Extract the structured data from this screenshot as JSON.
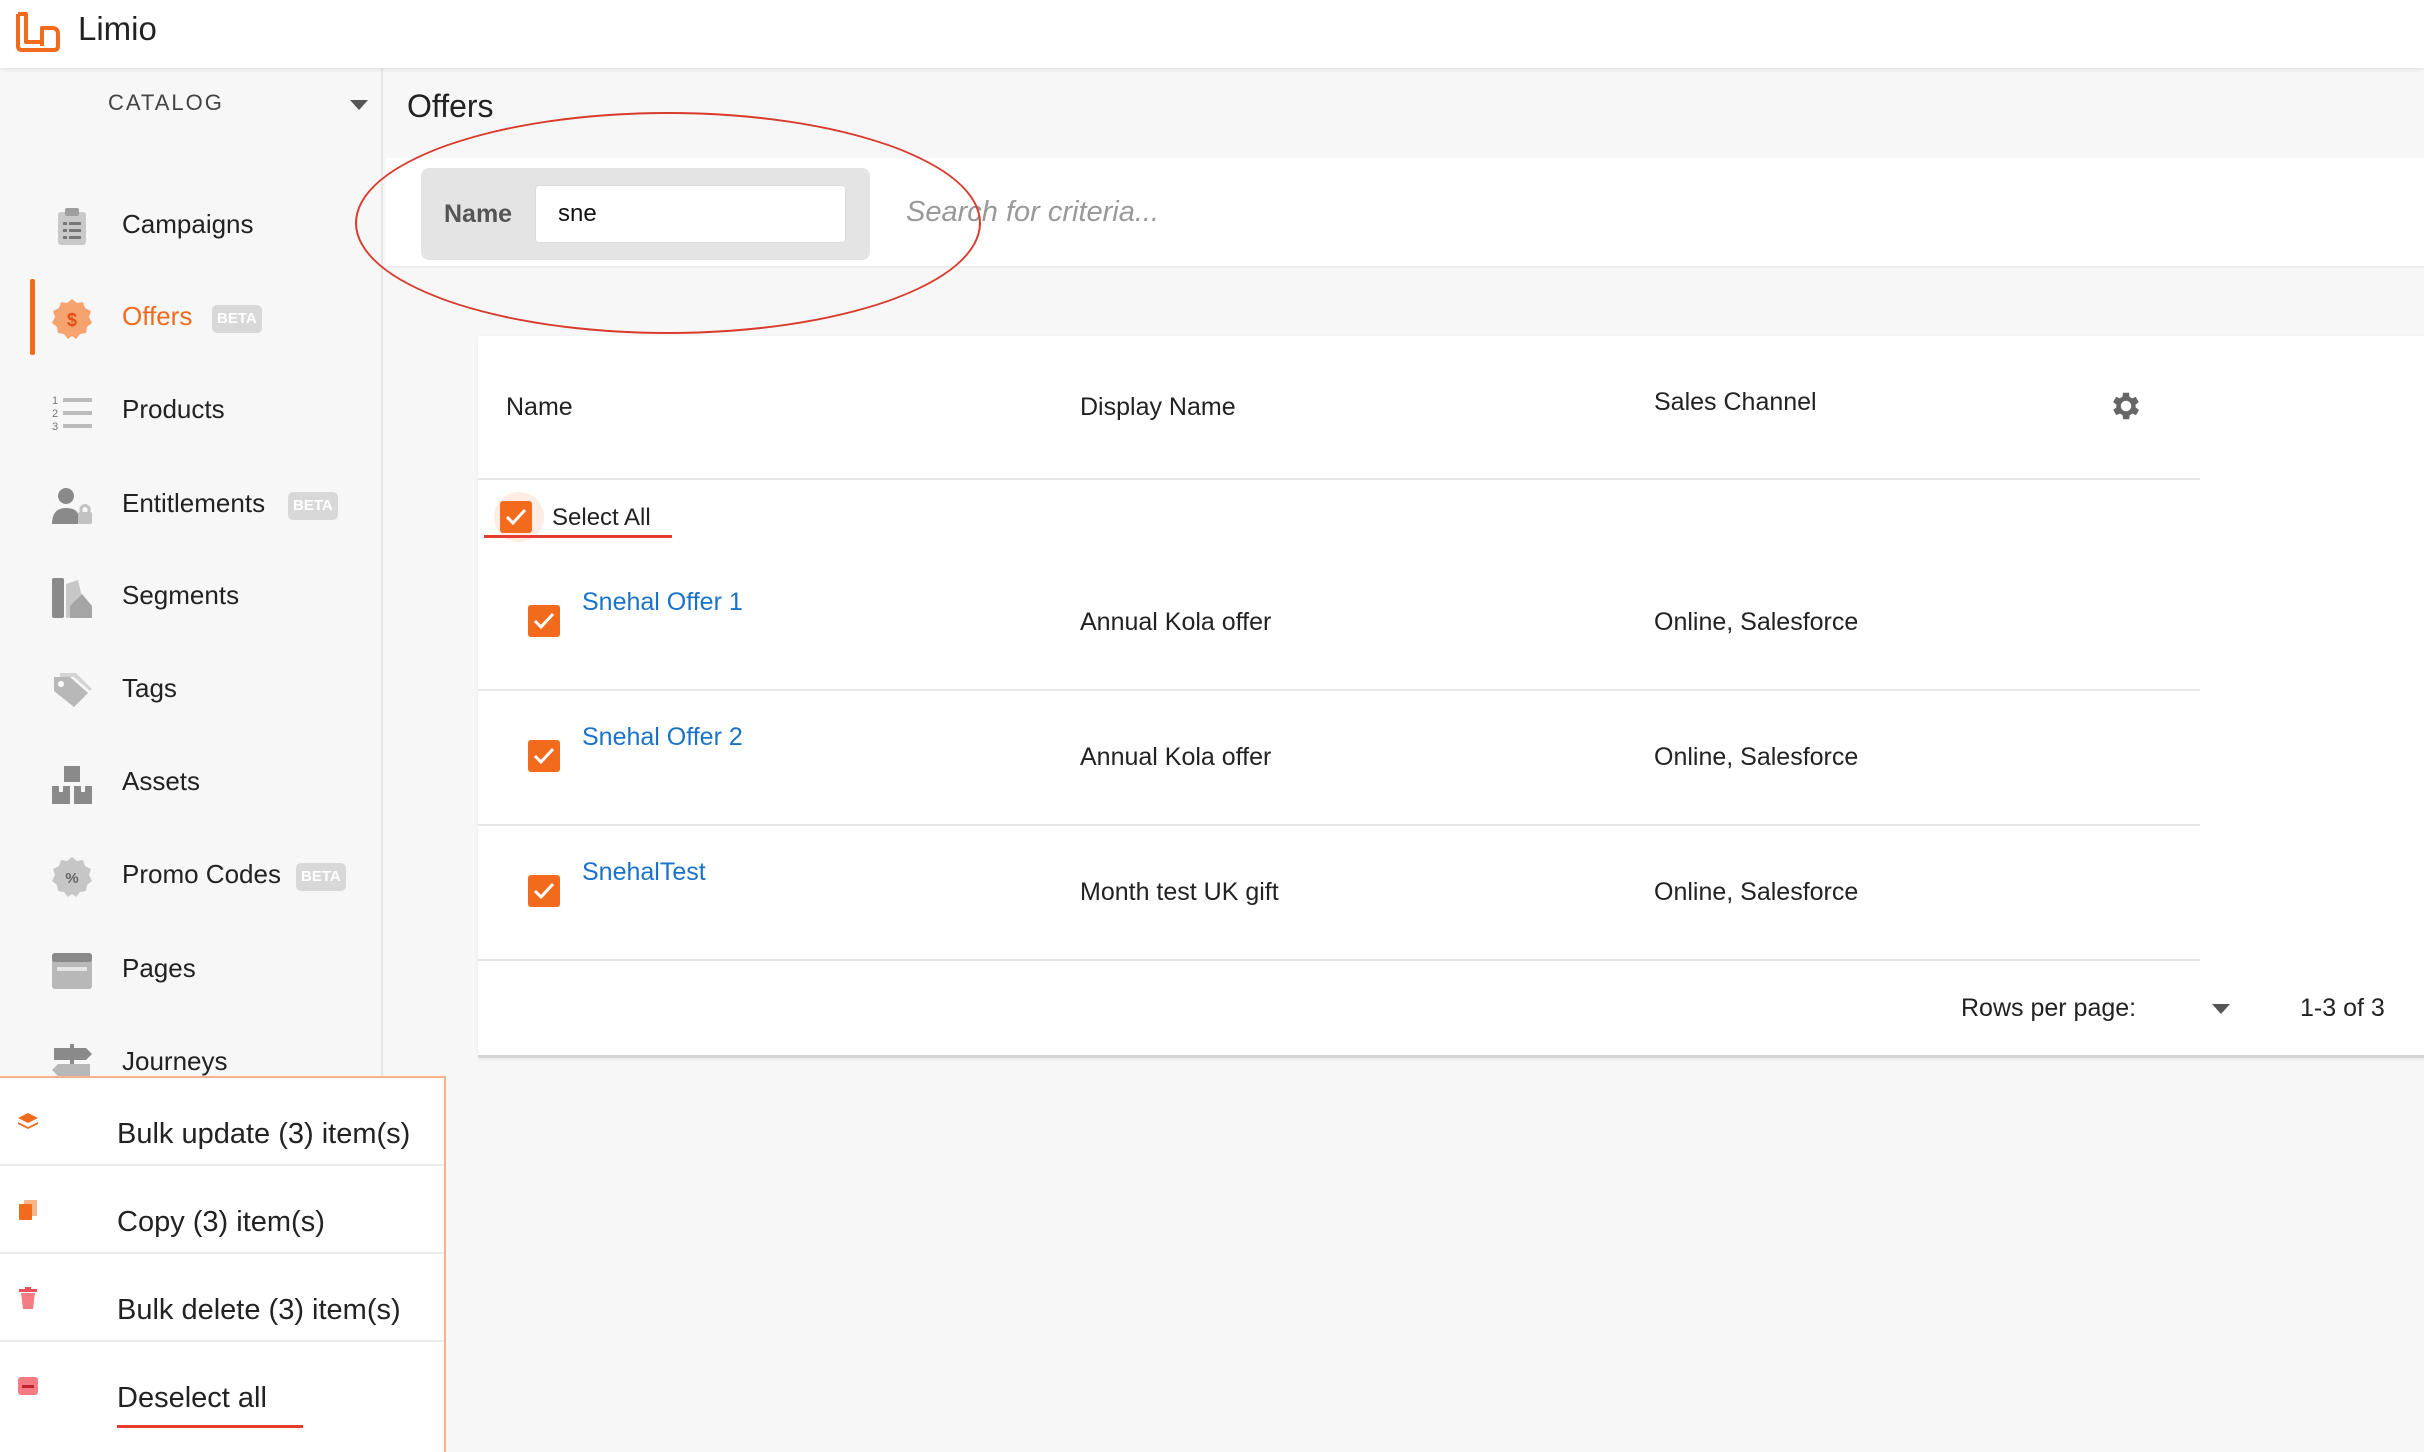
{
  "app": {
    "name": "Limio",
    "accent": "#f26b1d",
    "link_color": "#1a73c8"
  },
  "sidebar": {
    "section": "CATALOG",
    "items": [
      {
        "label": "Campaigns",
        "icon": "clipboard-icon",
        "active": false,
        "beta": ""
      },
      {
        "label": "Offers",
        "icon": "dollar-badge-icon",
        "active": true,
        "beta": "BETA"
      },
      {
        "label": "Products",
        "icon": "numbered-list-icon",
        "active": false,
        "beta": ""
      },
      {
        "label": "Entitlements",
        "icon": "user-lock-icon",
        "active": false,
        "beta": "BETA"
      },
      {
        "label": "Segments",
        "icon": "segments-icon",
        "active": false,
        "beta": ""
      },
      {
        "label": "Tags",
        "icon": "tags-icon",
        "active": false,
        "beta": ""
      },
      {
        "label": "Assets",
        "icon": "boxes-icon",
        "active": false,
        "beta": ""
      },
      {
        "label": "Promo Codes",
        "icon": "percent-badge-icon",
        "active": false,
        "beta": "BETA"
      },
      {
        "label": "Pages",
        "icon": "browser-window-icon",
        "active": false,
        "beta": ""
      },
      {
        "label": "Journeys",
        "icon": "signpost-icon",
        "active": false,
        "beta": ""
      }
    ]
  },
  "bulk_actions": [
    {
      "label": "Bulk update (3) item(s)",
      "icon": "layers-icon"
    },
    {
      "label": "Copy (3) item(s)",
      "icon": "copy-icon"
    },
    {
      "label": "Bulk delete (3) item(s)",
      "icon": "trash-icon"
    },
    {
      "label": "Deselect all",
      "icon": "minus-square-icon"
    }
  ],
  "main": {
    "title": "Offers",
    "filter": {
      "label": "Name",
      "value": "sne",
      "search_placeholder": "Search for criteria..."
    },
    "table": {
      "columns": [
        "Name",
        "Display Name",
        "Sales Channel"
      ],
      "select_all_label": "Select All",
      "rows": [
        {
          "name": "Snehal Offer 1",
          "display_name": "Annual Kola offer",
          "sales_channel": "Online, Salesforce",
          "checked": true
        },
        {
          "name": "Snehal Offer 2",
          "display_name": "Annual Kola offer",
          "sales_channel": "Online, Salesforce",
          "checked": true
        },
        {
          "name": "SnehalTest",
          "display_name": "Month test UK gift",
          "sales_channel": "Online, Salesforce",
          "checked": true
        }
      ],
      "rows_per_page_label": "Rows per page:",
      "range": "1-3 of 3"
    }
  }
}
